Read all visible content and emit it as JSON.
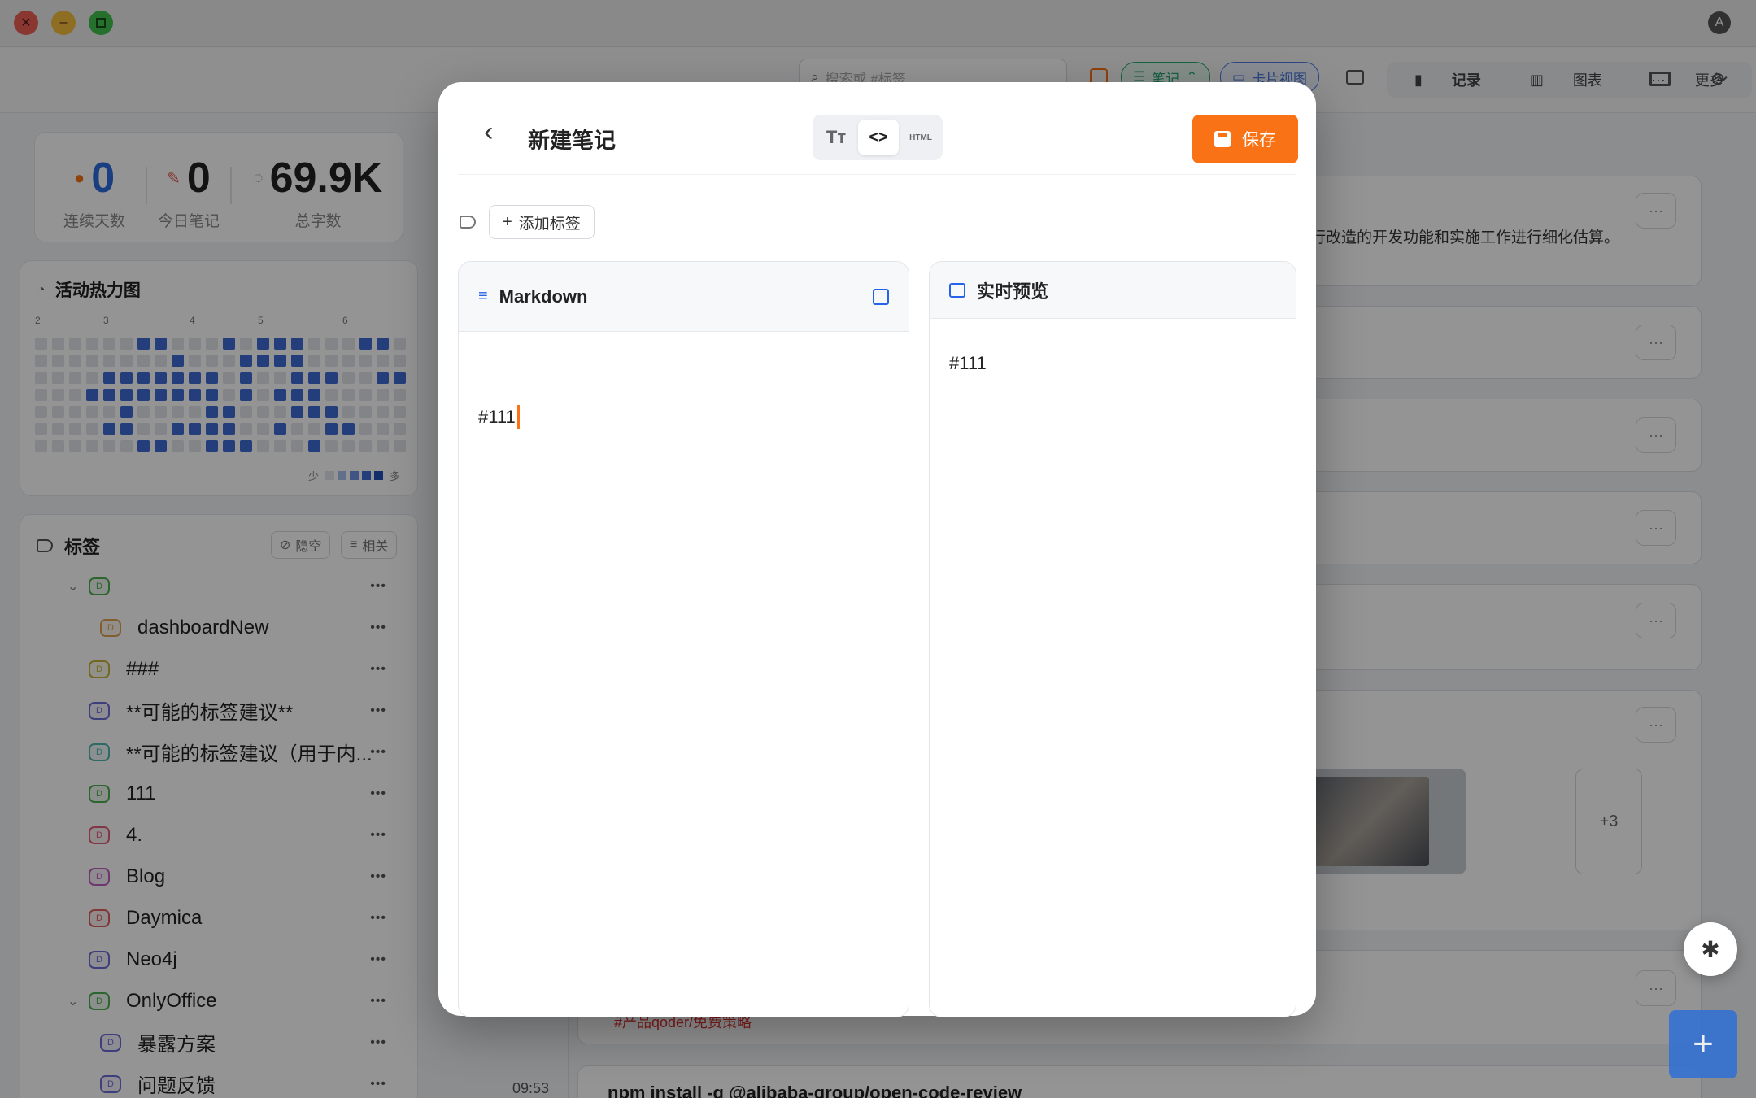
{
  "toolbar": {
    "search_placeholder": "搜索或 #标签",
    "filter_notes": "笔记",
    "card_view": "卡片视图",
    "seg_record": "记录",
    "seg_chart": "图表",
    "seg_more": "更多"
  },
  "stats": [
    {
      "value": "0",
      "label": "连续天数",
      "color": "#2b6de0"
    },
    {
      "value": "0",
      "label": "今日笔记",
      "color": "#222222"
    },
    {
      "value": "69.9K",
      "label": "总字数",
      "color": "#222222"
    }
  ],
  "heatmap": {
    "title": "活动热力图",
    "months": [
      "2",
      "3",
      "4",
      "5",
      "6"
    ],
    "legend_low": "少",
    "legend_high": "多",
    "levels": [
      [
        0,
        0,
        0,
        0,
        0,
        0,
        3,
        3,
        0,
        0,
        0,
        3,
        0,
        3,
        3,
        3,
        0,
        0,
        0,
        3,
        3,
        0
      ],
      [
        0,
        0,
        0,
        0,
        0,
        0,
        0,
        0,
        3,
        0,
        0,
        0,
        3,
        3,
        3,
        3,
        0,
        0,
        0,
        0,
        0,
        0
      ],
      [
        0,
        0,
        0,
        0,
        3,
        3,
        3,
        3,
        3,
        3,
        3,
        0,
        3,
        0,
        0,
        3,
        3,
        3,
        0,
        0,
        3,
        3
      ],
      [
        0,
        0,
        0,
        3,
        3,
        3,
        3,
        3,
        3,
        3,
        3,
        0,
        3,
        0,
        3,
        3,
        3,
        0,
        0,
        0,
        0,
        0
      ],
      [
        0,
        0,
        0,
        0,
        0,
        3,
        0,
        0,
        0,
        0,
        3,
        3,
        0,
        0,
        0,
        3,
        3,
        3,
        0,
        0,
        0,
        0
      ],
      [
        0,
        0,
        0,
        0,
        3,
        3,
        0,
        0,
        3,
        3,
        3,
        3,
        0,
        0,
        3,
        0,
        0,
        3,
        3,
        0,
        0,
        0
      ],
      [
        0,
        0,
        0,
        0,
        0,
        0,
        3,
        3,
        0,
        0,
        3,
        3,
        3,
        0,
        0,
        0,
        3,
        0,
        0,
        0,
        0,
        0
      ]
    ]
  },
  "tags": {
    "title": "标签",
    "hide_empty": "隐空",
    "related": "相关",
    "items": [
      {
        "label": "",
        "color": "#4caf50",
        "indent": 0,
        "caret": true
      },
      {
        "label": "dashboardNew",
        "color": "#e0a050",
        "indent": 1,
        "caret": false
      },
      {
        "label": "###",
        "color": "#c9b23a",
        "indent": 0,
        "caret": false
      },
      {
        "label": "**可能的标签建议**",
        "color": "#6c6cd6",
        "indent": 0,
        "caret": false
      },
      {
        "label": "**可能的标签建议（用于内...",
        "color": "#4fb7b0",
        "indent": 0,
        "caret": false
      },
      {
        "label": "111",
        "color": "#4caf50",
        "indent": 0,
        "caret": false
      },
      {
        "label": "4.",
        "color": "#e0607a",
        "indent": 0,
        "caret": false
      },
      {
        "label": "Blog",
        "color": "#c060c0",
        "indent": 0,
        "caret": false
      },
      {
        "label": "Daymica",
        "color": "#e06060",
        "indent": 0,
        "caret": false
      },
      {
        "label": "Neo4j",
        "color": "#6c6cd6",
        "indent": 0,
        "caret": false
      },
      {
        "label": "OnlyOffice",
        "color": "#4caf50",
        "indent": 0,
        "caret": true
      },
      {
        "label": "暴露方案",
        "color": "#6c6cd6",
        "indent": 1,
        "caret": false
      },
      {
        "label": "问题反馈",
        "color": "#6c6cd6",
        "indent": 1,
        "caret": false
      }
    ]
  },
  "notes_bg": {
    "note1_text": "行改造的开发功能和实施工作进行细化估算。",
    "more_count": "+3",
    "time": "09:53",
    "cmd_text": "npm install -g @alibaba-group/open-code-review",
    "red_text": "#产品qoder/免费策略"
  },
  "modal": {
    "title": "新建笔记",
    "mode_html": "HTML",
    "save": "保存",
    "add_tag": "添加标签",
    "editor_title": "Markdown",
    "editor_content": "#111",
    "preview_title": "实时预览",
    "preview_content": "#111"
  },
  "colors": {
    "accent_orange": "#f97316",
    "accent_blue": "#2563eb"
  }
}
